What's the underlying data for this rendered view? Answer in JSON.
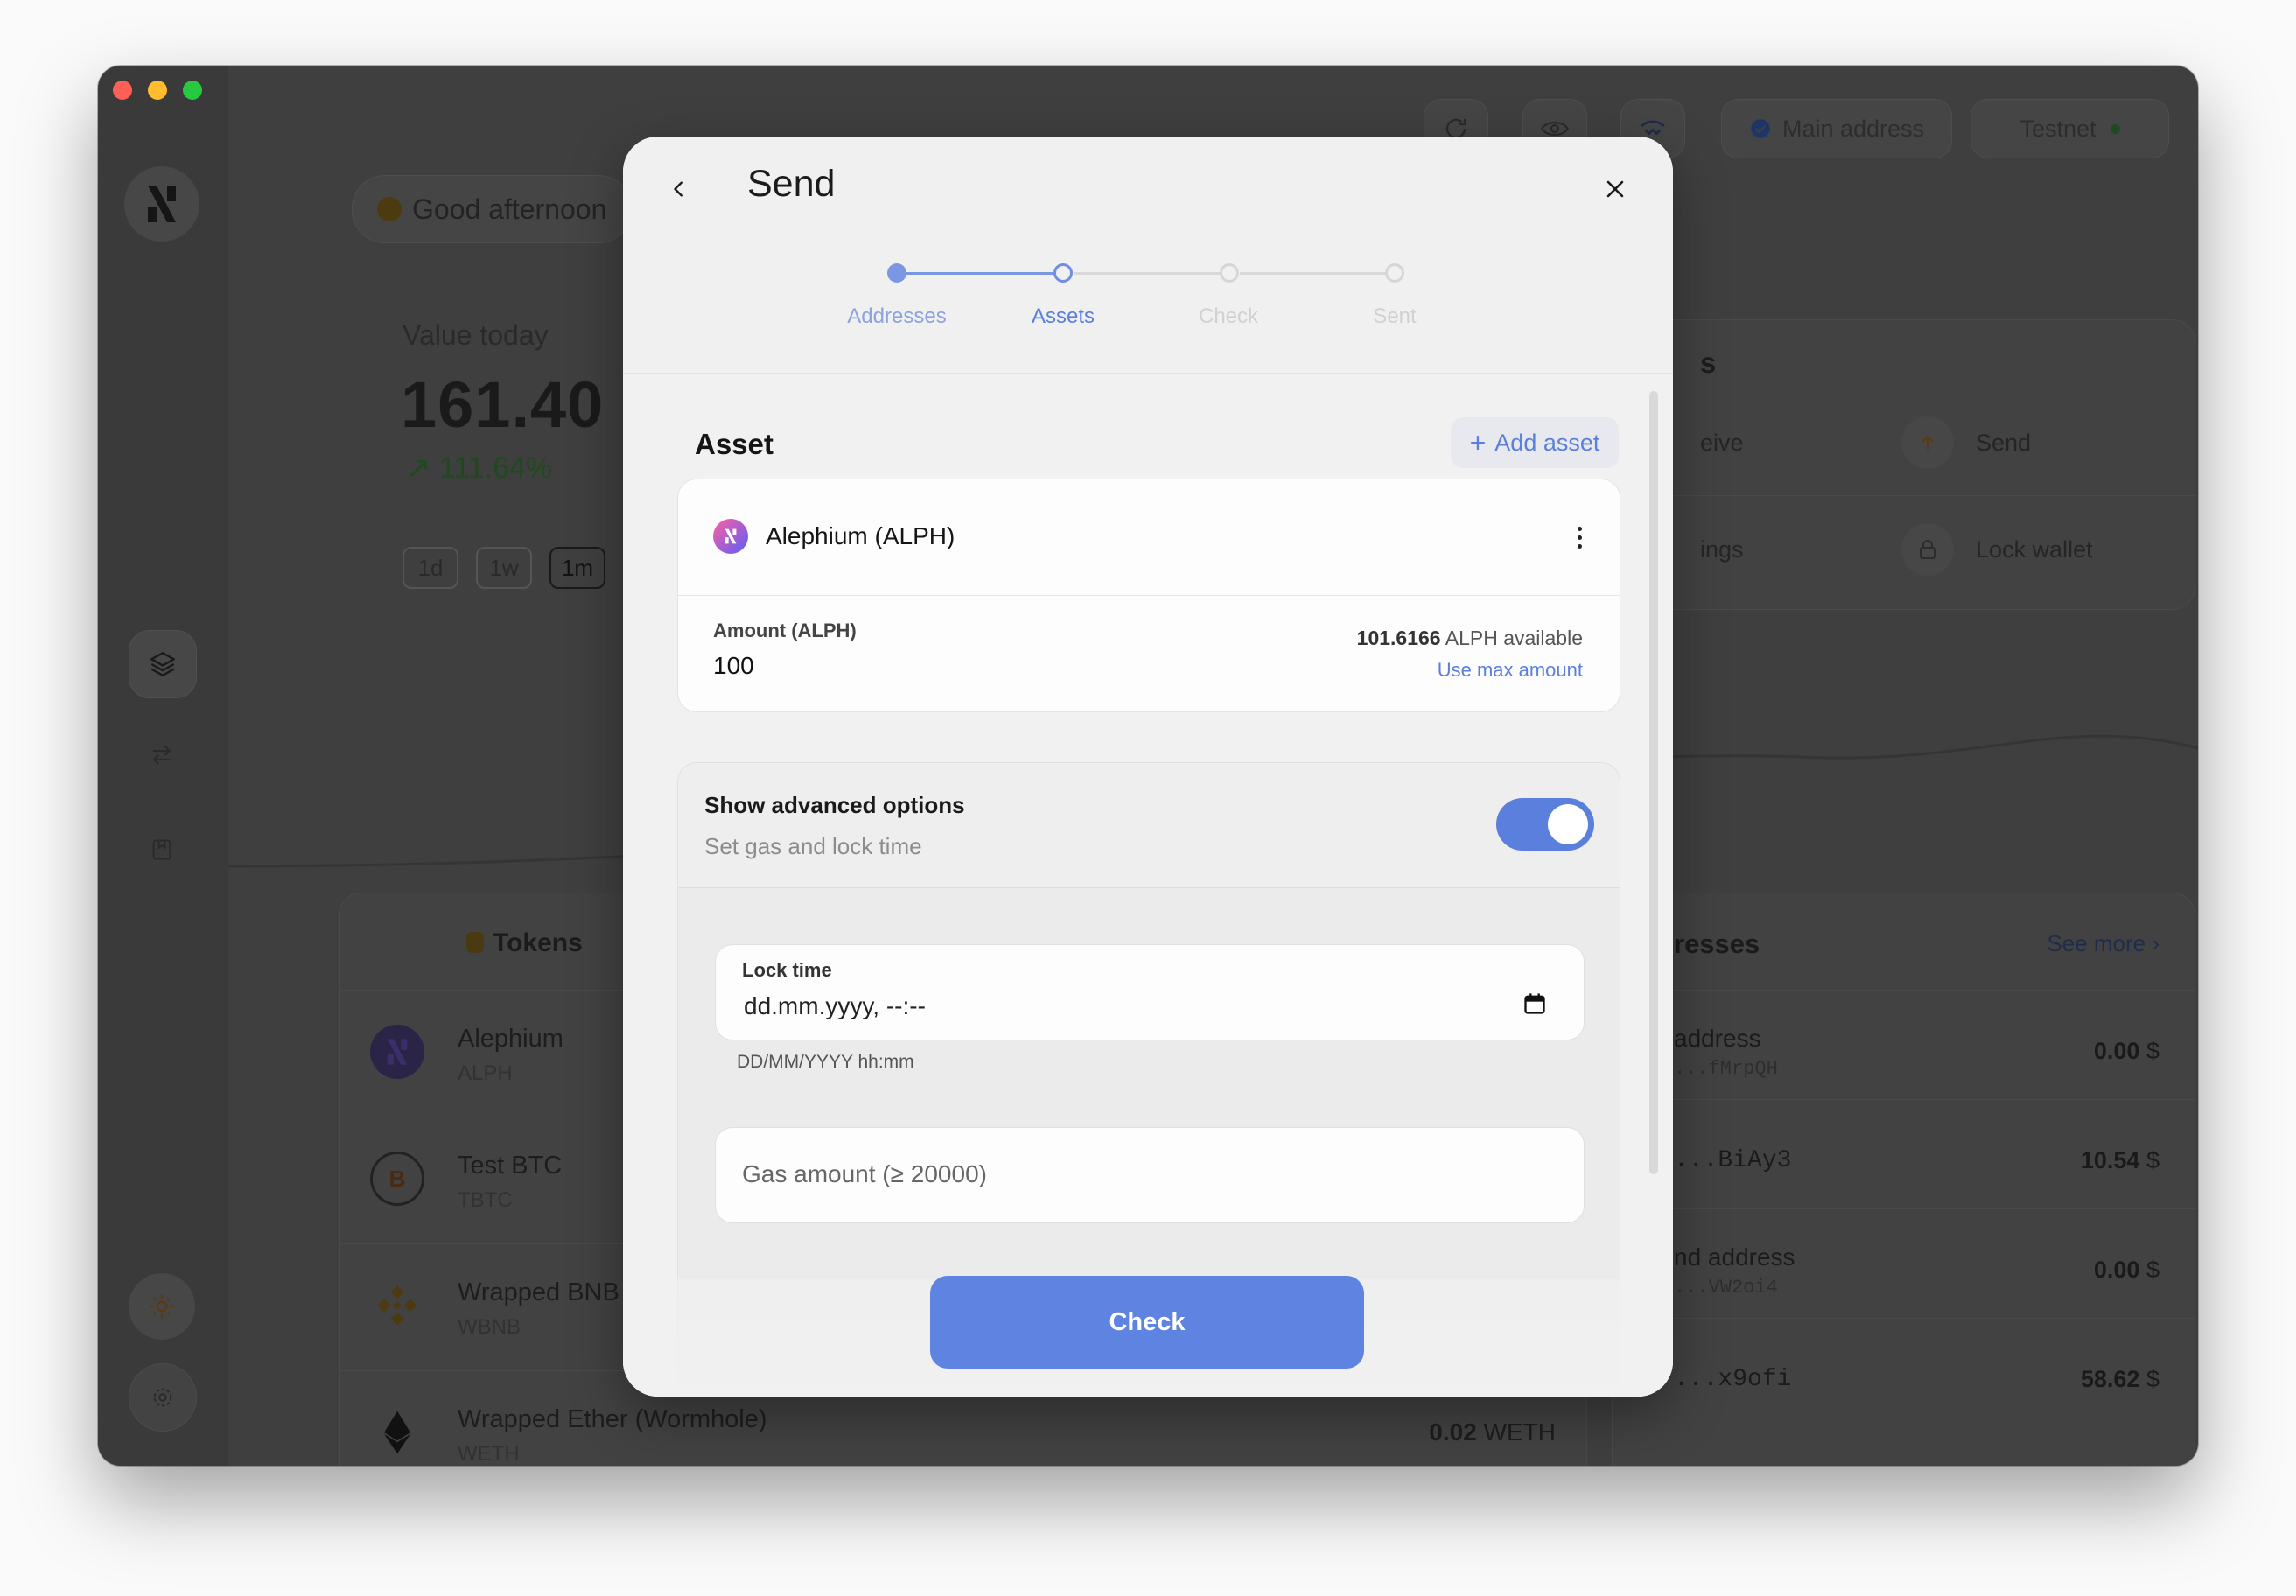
{
  "app": {
    "header": {
      "network": "Testnet",
      "main_address": "Main address"
    },
    "greeting": "Good afternoon",
    "value_label": "Value today",
    "value_amount": "161.40",
    "value_change": "111.64%",
    "time_ranges": [
      "1d",
      "1w",
      "1m"
    ],
    "shortcuts": {
      "receive": "eive",
      "send": "Send",
      "settings": "ings",
      "lock_wallet": "Lock wallet",
      "section_tail": "s"
    },
    "tokens_title": "Tokens",
    "tokens": [
      {
        "name": "Alephium",
        "symbol": "ALPH"
      },
      {
        "name": "Test BTC",
        "symbol": "TBTC"
      },
      {
        "name": "Wrapped BNB",
        "symbol": "WBNB"
      },
      {
        "name": "Wrapped Ether (Wormhole)",
        "symbol": "WETH",
        "amount": "0.02",
        "unit": "WETH"
      }
    ],
    "addresses_title": "resses",
    "see_more": "See more",
    "addresses": [
      {
        "label": "address",
        "hash": "...fMrpQH",
        "value": "0.00",
        "currency": "$"
      },
      {
        "label": "",
        "hash": "...BiAy3",
        "value": "10.54",
        "currency": "$"
      },
      {
        "label": "nd address",
        "hash": "...VW2oi4",
        "value": "0.00",
        "currency": "$"
      },
      {
        "label": "",
        "hash": "...x9ofi",
        "value": "58.62",
        "currency": "$"
      }
    ]
  },
  "modal": {
    "title": "Send",
    "steps": [
      {
        "label": "Addresses",
        "state": "done"
      },
      {
        "label": "Assets",
        "state": "current"
      },
      {
        "label": "Check",
        "state": "todo"
      },
      {
        "label": "Sent",
        "state": "todo"
      }
    ],
    "asset_section_title": "Asset",
    "add_asset_label": "Add asset",
    "asset": {
      "name": "Alephium (ALPH)",
      "amount_label": "Amount (ALPH)",
      "amount_value": "100",
      "available_amount": "101.6166",
      "available_suffix": "ALPH available",
      "use_max_label": "Use max amount"
    },
    "advanced": {
      "title": "Show advanced options",
      "subtitle": "Set gas and lock time",
      "enabled": true,
      "lock_time_label": "Lock time",
      "lock_time_placeholder": "dd.mm.yyyy, --:--",
      "lock_time_hint": "DD/MM/YYYY hh:mm",
      "gas_amount_placeholder": "Gas amount (≥ 20000)"
    },
    "check_button_label": "Check"
  },
  "colors": {
    "accent": "#5b7fdc",
    "button": "#5f83e0",
    "modal_bg": "#f1f1f1",
    "app_dimmed_bg": "#3f3f3f"
  }
}
